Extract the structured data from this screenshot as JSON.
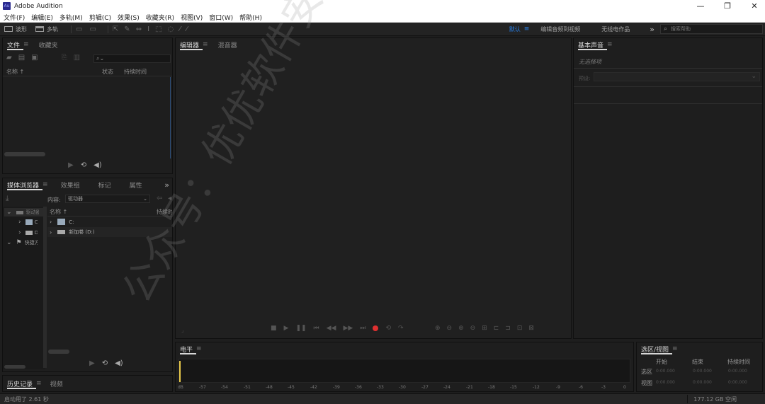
{
  "app": {
    "title": "Adobe Audition",
    "logo_text": "Au"
  },
  "window_controls": {
    "minimize": "—",
    "restore": "❐",
    "close": "✕"
  },
  "menu": [
    "文件(F)",
    "编辑(E)",
    "多轨(M)",
    "剪辑(C)",
    "效果(S)",
    "收藏夹(R)",
    "视图(V)",
    "窗口(W)",
    "帮助(H)"
  ],
  "toolbar": {
    "waveform_label": "波形",
    "multitrack_label": "多轨",
    "workspace_default": "默认",
    "workspace_edit_video": "编辑音频到视频",
    "workspace_radio": "无线电作品",
    "more": "»",
    "search_placeholder": "搜索帮助"
  },
  "files_panel": {
    "tabs": [
      "文件",
      "收藏夹"
    ],
    "search_placeholder": "",
    "columns": {
      "name": "名称 ↑",
      "status": "状态",
      "duration": "持续时间"
    }
  },
  "media_browser": {
    "tabs": [
      "媒体浏览器",
      "效果组",
      "标记",
      "属性"
    ],
    "more": "»",
    "content_label": "内容:",
    "content_value": "驱动器",
    "left_tree": [
      {
        "expander": "⌄",
        "label": "驱动器"
      },
      {
        "expander": "›",
        "label": "C:"
      },
      {
        "expander": "›",
        "label": "D:"
      },
      {
        "expander": "⌄",
        "label": "快捷方式"
      }
    ],
    "columns": {
      "name": "名称 ↑",
      "duration": "持续时"
    },
    "items": [
      {
        "expander": "›",
        "label": "C:"
      },
      {
        "expander": "›",
        "label": "新加卷 (D:)"
      }
    ]
  },
  "history_panel": {
    "tabs": [
      "历史记录",
      "视频"
    ]
  },
  "editor": {
    "tabs": [
      "编辑器",
      "混音器"
    ]
  },
  "essential_sound": {
    "tab": "基本声音",
    "no_selection": "无选择项",
    "preset_label": "预设:"
  },
  "levels": {
    "tab": "电平",
    "ruler": [
      "dB",
      "-57",
      "-54",
      "-51",
      "-48",
      "-45",
      "-42",
      "-39",
      "-36",
      "-33",
      "-30",
      "-27",
      "-24",
      "-21",
      "-18",
      "-15",
      "-12",
      "-9",
      "-6",
      "-3",
      "0"
    ]
  },
  "selection_view": {
    "tab": "选区/视图",
    "headers": [
      "开始",
      "结束",
      "持续时间"
    ],
    "rows": [
      {
        "label": "选区",
        "start": "0:00.000",
        "end": "0:00.000",
        "duration": "0:00.000"
      },
      {
        "label": "视图",
        "start": "0:00.000",
        "end": "0:00.000",
        "duration": "0:00.000"
      }
    ]
  },
  "status": {
    "startup": "启动用了 2.61 秒",
    "disk": "177.12 GB 空闲"
  },
  "watermark": {
    "line1": "公众号：优优软件安装"
  },
  "colors": {
    "accent": "#2680eb",
    "record": "#e03030",
    "playhead": "#e8c94a",
    "brand": "#2b2b8f"
  }
}
